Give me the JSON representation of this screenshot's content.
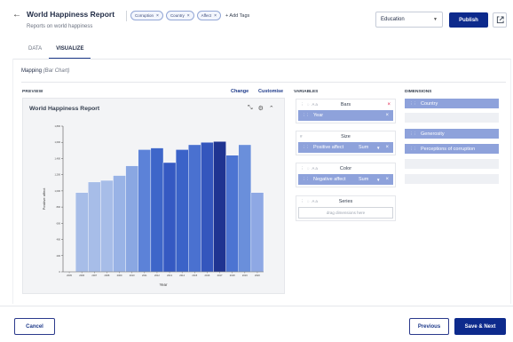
{
  "header": {
    "title": "World Happiness Report",
    "subtitle": "Reports on world happiness",
    "back_icon": "arrow-left-icon",
    "tags": [
      {
        "label": "Corruption"
      },
      {
        "label": "Country"
      },
      {
        "label": "Affect"
      }
    ],
    "add_tags_label": "+ Add Tags",
    "category_select": "Education",
    "publish_label": "Publish"
  },
  "tabs": [
    {
      "label": "DATA",
      "active": false
    },
    {
      "label": "VISUALIZE",
      "active": true
    }
  ],
  "mapping": {
    "label": "Mapping",
    "chart_type": "(Bar Chart)"
  },
  "preview": {
    "label": "PREVIEW",
    "change_label": "Change",
    "customise_label": "Customise",
    "chart_title": "World Happiness Report"
  },
  "variables": {
    "label": "VARIABLES",
    "bars": {
      "label": "Bars",
      "required_mark": "×",
      "chip": {
        "label": "Year"
      }
    },
    "size": {
      "label": "Size",
      "chip": {
        "label": "Positive affect",
        "agg": "Sum"
      }
    },
    "color": {
      "label": "Color",
      "chip": {
        "label": "Negative affect",
        "agg": "Sum"
      }
    },
    "series": {
      "label": "Series",
      "placeholder": "drag dimensions here"
    }
  },
  "dimensions": {
    "label": "DIMENSIONS",
    "items": [
      {
        "label": "Country",
        "filled": true
      },
      {
        "label": "",
        "filled": false
      },
      {
        "label": "Generosity",
        "filled": true
      },
      {
        "label": "Perceptions of corruption",
        "filled": true
      },
      {
        "label": "",
        "filled": false
      },
      {
        "label": "",
        "filled": false
      }
    ]
  },
  "footer": {
    "cancel_label": "Cancel",
    "previous_label": "Previous",
    "save_next_label": "Save & Next"
  },
  "chart_data": {
    "type": "bar",
    "title": "World Happiness Report",
    "xlabel": "Year",
    "ylabel": "Positive affect",
    "categories": [
      "2005",
      "2006",
      "2007",
      "2008",
      "2009",
      "2010",
      "2011",
      "2012",
      "2013",
      "2014",
      "2015",
      "2016",
      "2017",
      "2018",
      "2019",
      "2020"
    ],
    "values": [
      0,
      980,
      1110,
      1130,
      1190,
      1310,
      1510,
      1530,
      1350,
      1510,
      1570,
      1600,
      1610,
      1440,
      1570,
      980
    ],
    "colors": [
      "#ffffff",
      "#a7bde8",
      "#a7bde8",
      "#a7bde8",
      "#99b3e6",
      "#8aa7e2",
      "#5c82d8",
      "#3e66c9",
      "#3559c2",
      "#3b63c8",
      "#4a71d0",
      "#3456bd",
      "#1f3491",
      "#4c74d2",
      "#6a8fdb",
      "#8ea8e4"
    ],
    "ylim": [
      0,
      1800
    ],
    "yticks": [
      "0",
      "200",
      "400",
      "600",
      "800",
      "1,000",
      "1,200",
      "1,400",
      "1,600",
      "1,800"
    ],
    "grid": false,
    "legend": "none"
  }
}
